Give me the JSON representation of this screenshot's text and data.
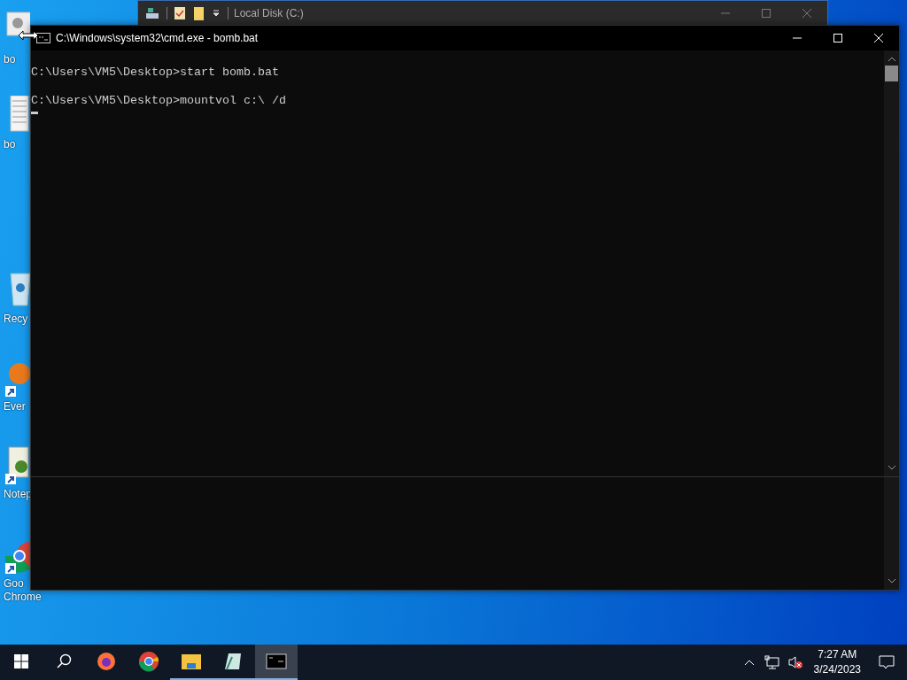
{
  "desktop_icons": [
    {
      "label_lines": [
        "bo"
      ],
      "kind": "settings-file",
      "shortcut": false
    },
    {
      "label_lines": [
        "bo"
      ],
      "kind": "text-file",
      "shortcut": false
    },
    {
      "label_lines": [
        "Recy"
      ],
      "kind": "recycle-bin",
      "shortcut": false
    },
    {
      "label_lines": [
        "Ever"
      ],
      "kind": "orange-app",
      "shortcut": true
    },
    {
      "label_lines": [
        "Notep"
      ],
      "kind": "notepad",
      "shortcut": true
    },
    {
      "label_lines": [
        "Goo",
        "Chrome"
      ],
      "kind": "chrome",
      "shortcut": true
    }
  ],
  "explorer_window": {
    "title": "Local Disk (C:)"
  },
  "cmd_window": {
    "title": "C:\\Windows\\system32\\cmd.exe - bomb.bat",
    "lines": [
      "C:\\Users\\VM5\\Desktop>start bomb.bat",
      "C:\\Users\\VM5\\Desktop>mountvol c:\\ /d"
    ]
  },
  "taskbar": {
    "apps": [
      {
        "kind": "firefox",
        "running": false,
        "selected": false
      },
      {
        "kind": "chrome",
        "running": false,
        "selected": false
      },
      {
        "kind": "folder",
        "running": true,
        "selected": false
      },
      {
        "kind": "notepad",
        "running": true,
        "selected": false
      },
      {
        "kind": "console",
        "running": true,
        "selected": true
      }
    ],
    "clock": {
      "time": "7:27 AM",
      "date": "3/24/2023"
    }
  }
}
